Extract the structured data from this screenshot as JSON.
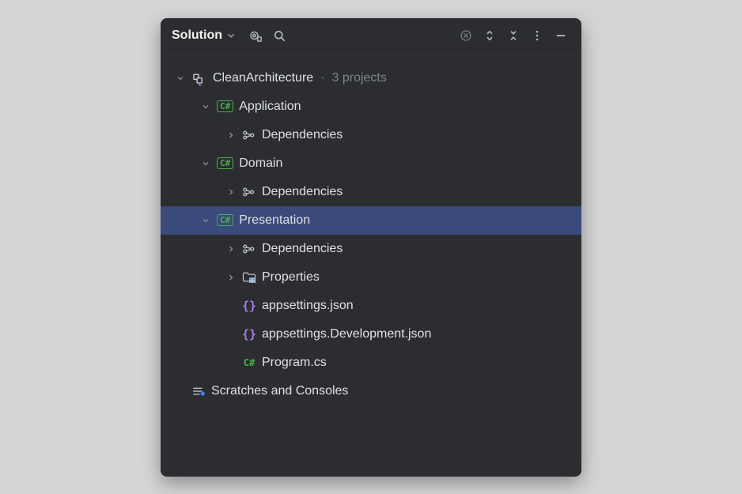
{
  "toolbar": {
    "title": "Solution"
  },
  "solution": {
    "name": "CleanArchitecture",
    "projects_hint": "3 projects"
  },
  "projects": [
    {
      "name": "Application",
      "deps_label": "Dependencies"
    },
    {
      "name": "Domain",
      "deps_label": "Dependencies"
    },
    {
      "name": "Presentation",
      "deps_label": "Dependencies",
      "properties_label": "Properties",
      "files": [
        "appsettings.json",
        "appsettings.Development.json",
        "Program.cs"
      ]
    }
  ],
  "scratches_label": "Scratches and Consoles"
}
